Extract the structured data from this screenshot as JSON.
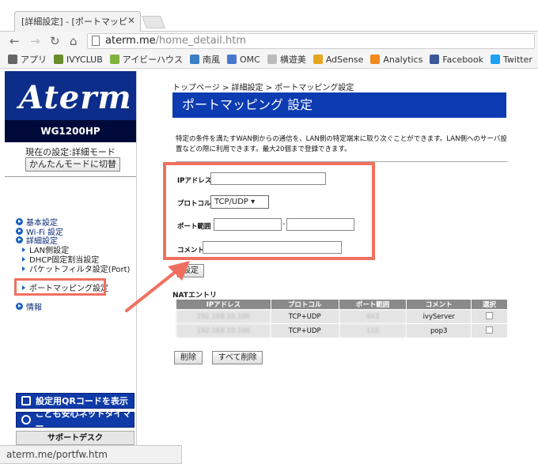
{
  "browser": {
    "tab_title": "[詳細設定] - [ポートマッピ",
    "url_host": "aterm.me",
    "url_path": "/home_detail.htm",
    "bookmarks": [
      {
        "label": "アプリ",
        "color": "#666666"
      },
      {
        "label": "IVYCLUB",
        "color": "#6a8c2a"
      },
      {
        "label": "アイビーハウス",
        "color": "#7fb33c"
      },
      {
        "label": "南風",
        "color": "#3b7fc4"
      },
      {
        "label": "OMC",
        "color": "#4a78d0"
      },
      {
        "label": "横遊美",
        "color": "#bbbbbb"
      },
      {
        "label": "AdSense",
        "color": "#e6a51c"
      },
      {
        "label": "Analytics",
        "color": "#f08a1c"
      },
      {
        "label": "Facebook",
        "color": "#3b5998"
      },
      {
        "label": "Twitter",
        "color": "#1da1f2"
      }
    ],
    "status_url": "aterm.me/portfw.htm"
  },
  "sidebar": {
    "logo": "Aterm",
    "model": "WG1200HP",
    "mode_text": "現在の設定:詳細モード",
    "mode_button": "かんたんモードに切替",
    "menu": [
      {
        "label": "基本設定",
        "type": "main"
      },
      {
        "label": "Wi-Fi 設定",
        "type": "main"
      },
      {
        "label": "詳細設定",
        "type": "main"
      },
      {
        "label": "LAN側設定",
        "type": "sub"
      },
      {
        "label": "DHCP固定割当設定",
        "type": "sub"
      },
      {
        "label": "パケットフィルタ設定(Port)",
        "type": "sub"
      },
      {
        "label": "ポートマッピング設定",
        "type": "sub"
      },
      {
        "label": "情報",
        "type": "main"
      }
    ],
    "qr_button": "設定用QRコードを表示",
    "kids_button": "こども安心ネットタイマー",
    "support_button": "サポートデスク"
  },
  "main": {
    "breadcrumb": "トップページ > 詳細設定 > ポートマッピング設定",
    "title": "ポートマッピング 設定",
    "description": "特定の条件を満たすWAN側からの通信を、LAN側の特定端末に取り次ぐことができます。LAN側へのサーバ設置などの際に利用できます。最大20個まで登録できます。",
    "form": {
      "ip_label": "IPアドレス",
      "protocol_label": "プロトコル",
      "protocol_value": "TCP/UDP",
      "port_label": "ポート範囲",
      "comment_label": "コメント",
      "port_separator": "-"
    },
    "set_button": "設定",
    "nat_title": "NATエントリ",
    "nat_headers": [
      "IPアドレス",
      "プロトコル",
      "ポート範囲",
      "コメント",
      "選択"
    ],
    "nat_rows": [
      {
        "ip": "192.168.10.100",
        "protocol": "TCP+UDP",
        "port": "443",
        "comment": "ivyServer"
      },
      {
        "ip": "192.168.10.100",
        "protocol": "TCP+UDP",
        "port": "110",
        "comment": "pop3"
      }
    ],
    "delete_button": "削除",
    "delete_all_button": "すべて削除"
  },
  "colors": {
    "accent": "#0c3bb2",
    "highlight": "#f07060"
  }
}
